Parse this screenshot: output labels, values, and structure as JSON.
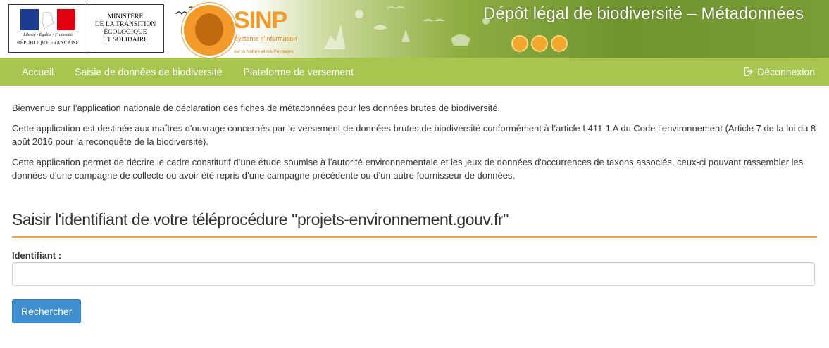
{
  "header": {
    "logo_rf": {
      "motto": "Liberté • Égalité • Fraternité",
      "country": "RÉPUBLIQUE FRANÇAISE",
      "ministry": "MINISTÈRE\nDE LA TRANSITION\nÉCOLOGIQUE\nET SOLIDAIRE",
      "flag_colors": [
        "#1a3b8f",
        "#ffffff",
        "#e1000f"
      ]
    },
    "logo_sinp": {
      "title": "SINP",
      "subtitle": "Système d'Information",
      "subtitle2": "sur la Nature et les Paysages",
      "color": "#f39a2b"
    },
    "app_title": "Dépôt légal de biodiversité – Métadonnées"
  },
  "nav": {
    "items": [
      {
        "label": "Accueil"
      },
      {
        "label": "Saisie de données de biodiversité"
      },
      {
        "label": "Plateforme de versement"
      }
    ],
    "logout": {
      "label": "Déconnexion",
      "icon": "logout-icon"
    },
    "color": "#a8c64f"
  },
  "main": {
    "paragraphs": [
      "Bienvenue sur l’application nationale de déclaration des fiches de métadonnées pour les données brutes de biodiversité.",
      "Cette application est destinée aux maîtres d'ouvrage concernés par le versement de données brutes de biodiversité conformément à l’article L411-1 A du Code l’environnement (Article 7 de la loi du 8 août 2016 pour la reconquête de la biodiversité).",
      "Cette application permet de décrire le cadre constitutif d’une étude soumise à l’autorité environnementale et les jeux de données d'occurrences de taxons associés, ceux-ci pouvant rassembler les données d’une campagne de collecte ou avoir été repris d’une campagne précédente ou d’un autre fournisseur de données."
    ],
    "form": {
      "title": "Saisir l'identifiant de votre téléprocédure \"projets-environnement.gouv.fr\"",
      "field_label": "Identifiant :",
      "field_value": "",
      "field_placeholder": "",
      "submit_label": "Rechercher",
      "accent_color": "#f0a23c",
      "button_color": "#3f8fd0"
    }
  }
}
